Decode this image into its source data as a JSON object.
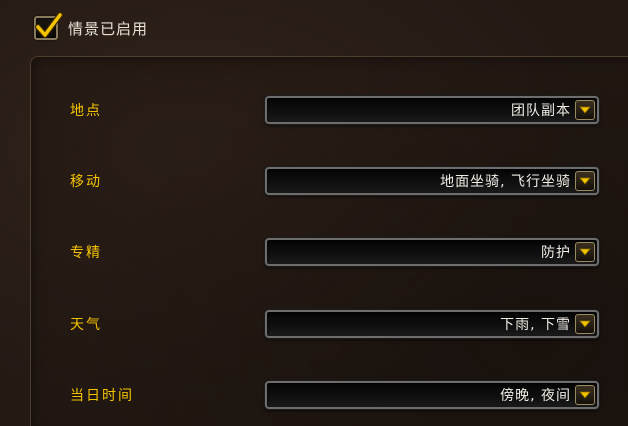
{
  "enable": {
    "label": "情景已启用",
    "checked": true,
    "icon": "checkmark-icon"
  },
  "settings": [
    {
      "label": "地点",
      "value": "团队副本"
    },
    {
      "label": "移动",
      "value": "地面坐骑, 飞行坐骑"
    },
    {
      "label": "专精",
      "value": "防护"
    },
    {
      "label": "天气",
      "value": "下雨, 下雪"
    },
    {
      "label": "当日时间",
      "value": "傍晚, 夜间"
    }
  ],
  "colors": {
    "label_gold": "#f5c400",
    "check_gold": "#f5c400",
    "background": "#241a14"
  },
  "dropdown_icon": "chevron-down-icon"
}
